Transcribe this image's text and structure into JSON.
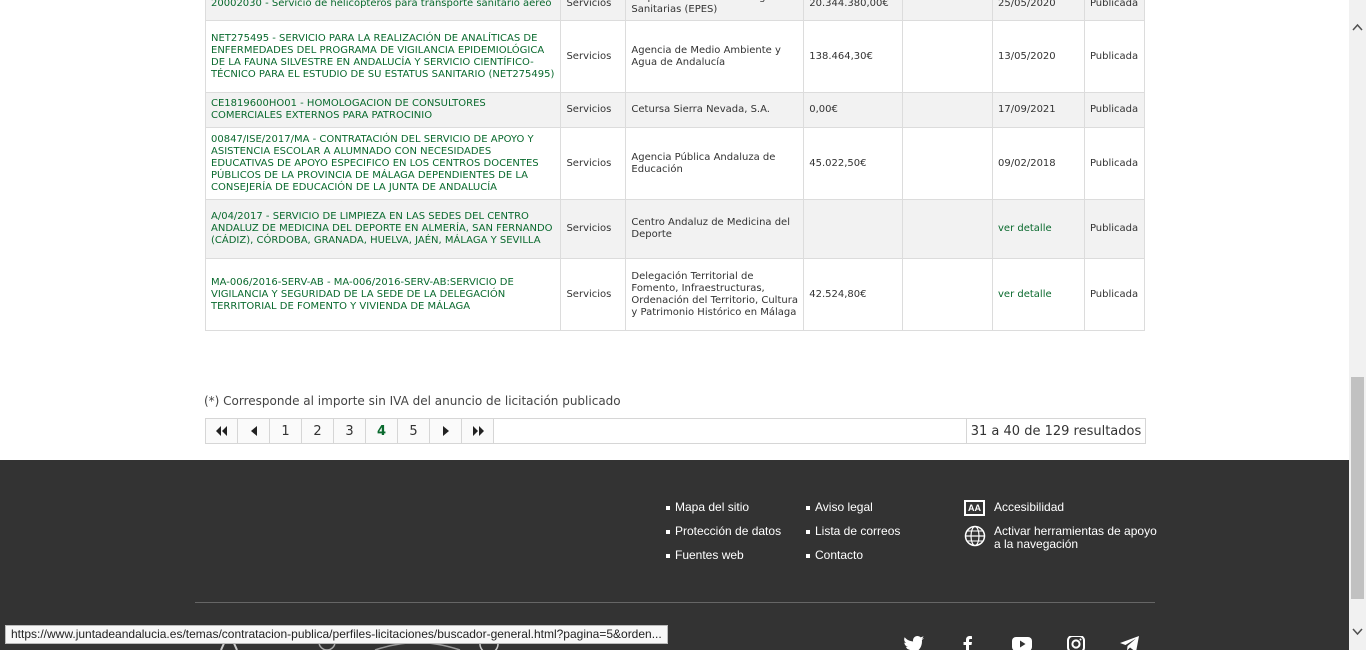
{
  "rows": [
    {
      "title": "20002030 - Servicio de helicópteros para transporte sanitario aéreo",
      "type": "Servicios",
      "org": "Empresa Pública de Emergencias Sanitarias (EPES)",
      "amount": "20.344.380,00€",
      "extra": "",
      "date": "25/05/2020",
      "state": "Publicada",
      "h": 34
    },
    {
      "title": "NET275495 - SERVICIO PARA LA REALIZACIÓN DE ANALÍTICAS DE ENFERMEDADES DEL PROGRAMA DE VIGILANCIA EPIDEMIOLÓGICA DE LA FAUNA SILVESTRE EN ANDALUCÍA Y SERVICIO CIENTÍFICO-TÉCNICO PARA EL ESTUDIO DE SU ESTATUS SANITARIO (NET275495)",
      "type": "Servicios",
      "org": "Agencia de Medio Ambiente y Agua de Andalucía",
      "amount": "138.464,30€",
      "extra": "",
      "date": "13/05/2020",
      "state": "Publicada",
      "h": 72
    },
    {
      "title": "CE1819600HO01 - HOMOLOGACION DE CONSULTORES COMERCIALES EXTERNOS PARA PATROCINIO",
      "type": "Servicios",
      "org": "Cetursa Sierra Nevada, S.A.",
      "amount": "0,00€",
      "extra": "",
      "date": "17/09/2021",
      "state": "Publicada",
      "h": 35
    },
    {
      "title": "00847/ISE/2017/MA - CONTRATACIÓN DEL SERVICIO DE APOYO Y ASISTENCIA ESCOLAR A ALUMNADO CON NECESIDADES EDUCATIVAS DE APOYO ESPECIFICO EN LOS CENTROS DOCENTES PÚBLICOS DE LA PROVINCIA DE MÁLAGA DEPENDIENTES DE LA CONSEJERÍA DE EDUCACIÓN DE LA JUNTA DE ANDALUCÍA",
      "type": "Servicios",
      "org": "Agencia Pública Andaluza de Educación",
      "amount": "45.022,50€",
      "extra": "",
      "date": "09/02/2018",
      "state": "Publicada",
      "h": 72
    },
    {
      "title": "A/04/2017 - SERVICIO DE LIMPIEZA EN LAS SEDES DEL CENTRO ANDALUZ DE MEDICINA DEL DEPORTE EN ALMERÍA, SAN FERNANDO (CÁDIZ), CÓRDOBA, GRANADA, HUELVA, JAÉN, MÁLAGA Y SEVILLA",
      "type": "Servicios",
      "org": "Centro Andaluz de Medicina del Deporte",
      "amount": "",
      "extra": "",
      "date": "ver detalle",
      "state": "Publicada",
      "h": 59
    },
    {
      "title": "MA-006/2016-SERV-AB - MA-006/2016-SERV-AB:SERVICIO DE VIGILANCIA Y SEGURIDAD DE LA SEDE DE LA DELEGACIÓN TERRITORIAL DE FOMENTO Y VIVIENDA DE MÁLAGA",
      "type": "Servicios",
      "org": "Delegación Territorial de Fomento, Infraestructuras, Ordenación del Territorio, Cultura y Patrimonio Histórico en Málaga",
      "amount": "42.524,80€",
      "extra": "",
      "date": "ver detalle",
      "state": "Publicada",
      "h": 72
    }
  ],
  "footnote": "(*) Corresponde al importe sin IVA del anuncio de licitación publicado",
  "pager": {
    "pages": [
      "1",
      "2",
      "3",
      "4",
      "5"
    ],
    "active": "4",
    "count": "31 a 40 de 129 resultados"
  },
  "footer": {
    "col1": [
      "Mapa del sitio",
      "Protección de datos",
      "Fuentes web"
    ],
    "col2": [
      "Aviso legal",
      "Lista de correos",
      "Contacto"
    ],
    "accessibility": "Accesibilidad",
    "aa": "AA",
    "nav_tools": "Activar herramientas de apoyo a la navegación"
  },
  "status_url": "https://www.juntadeandalucia.es/temas/contratacion-publica/perfiles-licitaciones/buscador-general.html?pagina=5&orden..."
}
